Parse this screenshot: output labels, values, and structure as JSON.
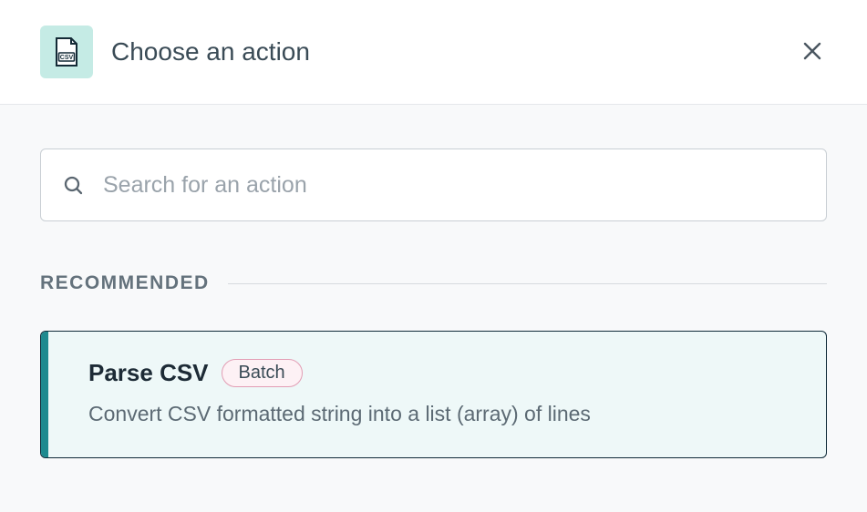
{
  "header": {
    "title": "Choose an action",
    "icon_name": "csv-file-icon"
  },
  "search": {
    "placeholder": "Search for an action",
    "value": ""
  },
  "section": {
    "label": "RECOMMENDED"
  },
  "actions": [
    {
      "title": "Parse CSV",
      "badge": "Batch",
      "description": "Convert CSV formatted string into a list (array) of lines"
    }
  ],
  "colors": {
    "accent": "#1e8a8f",
    "icon_bg": "#c5ebe5",
    "card_bg": "#eef8f8",
    "badge_border": "#e29db4",
    "badge_bg": "#fdf1f5"
  }
}
